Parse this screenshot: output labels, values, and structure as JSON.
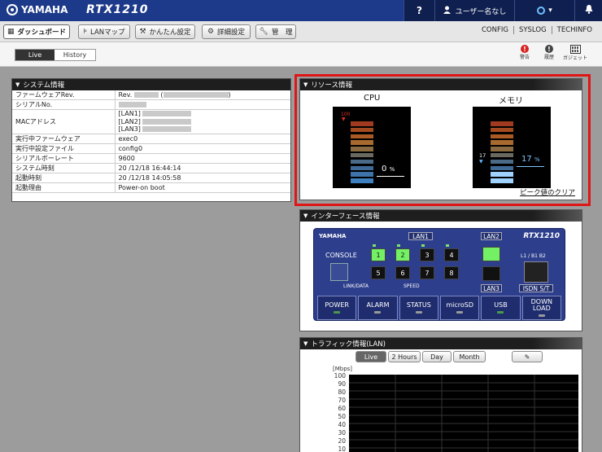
{
  "topbar": {
    "brand": "YAMAHA",
    "model": "RTX1210",
    "help": "?",
    "user": "ユーザー名なし",
    "lang_caret": "▾"
  },
  "menu": {
    "items": [
      {
        "label": "ダッシュボード",
        "icon": "dashboard-icon"
      },
      {
        "label": "LANマップ",
        "icon": "lanmap-icon"
      },
      {
        "label": "かんたん設定",
        "icon": "wrench-person-icon"
      },
      {
        "label": "詳細設定",
        "icon": "gear-icon"
      },
      {
        "label": "管　理",
        "icon": "wrench-icon"
      }
    ],
    "right_links": [
      "CONFIG",
      "SYSLOG",
      "TECHINFO"
    ]
  },
  "subbar": {
    "tabs": [
      "Live",
      "History"
    ],
    "tools": [
      {
        "label": "警告",
        "icon": "warning-icon"
      },
      {
        "label": "履歴",
        "icon": "history-icon"
      },
      {
        "label": "ガジェット",
        "icon": "gadget-icon"
      }
    ]
  },
  "system": {
    "title": "システム情報",
    "rows": [
      {
        "key": "ファームウェアRev.",
        "value": "Rev."
      },
      {
        "key": "シリアルNo.",
        "value": ""
      },
      {
        "key": "MACアドレス",
        "value": "[LAN1]\n[LAN2]\n[LAN3]"
      },
      {
        "key": "実行中ファームウェア",
        "value": "exec0"
      },
      {
        "key": "実行中設定ファイル",
        "value": "config0"
      },
      {
        "key": "シリアルボーレート",
        "value": "9600"
      },
      {
        "key": "システム時刻",
        "value": "20  /12/18 16:44:14"
      },
      {
        "key": "起動時刻",
        "value": "20  /12/18 14:05:58"
      },
      {
        "key": "起動理由",
        "value": "Power-on boot"
      }
    ]
  },
  "resource": {
    "title": "リソース情報",
    "cpu": {
      "label": "CPU",
      "peak": "100",
      "value": "0",
      "unit": "%",
      "level": 0.0
    },
    "memory": {
      "label": "メモリ",
      "peak": "17",
      "value": "17",
      "unit": "%",
      "level": 0.17
    },
    "clear_peak": "ピーク値のクリア"
  },
  "interface": {
    "title": "インターフェース情報",
    "brand": "YAMAHA",
    "model": "RTX1210",
    "console": "CONSOLE",
    "link_data": "LINK/DATA",
    "speed": "SPEED",
    "lan1": "LAN1",
    "lan2": "LAN2",
    "lan3": "LAN3",
    "isdn_top": "L1 / B1 B2",
    "isdn": "ISDN S/T",
    "ports": [
      "1",
      "2",
      "3",
      "4",
      "5",
      "6",
      "7",
      "8"
    ],
    "ports_up": [
      true,
      true,
      false,
      false,
      false,
      false,
      false,
      false
    ],
    "status": [
      {
        "label": "POWER",
        "on": true
      },
      {
        "label": "ALARM",
        "on": false
      },
      {
        "label": "STATUS",
        "on": false
      },
      {
        "label": "microSD",
        "on": false
      },
      {
        "label": "USB",
        "on": true
      },
      {
        "label": "DOWN\nLOAD",
        "on": false
      }
    ]
  },
  "traffic": {
    "title": "トラフィック情報(LAN)",
    "tabs": [
      "Live",
      "2 Hours",
      "Day",
      "Month"
    ],
    "unit": "[Mbps]",
    "yticks": [
      "100",
      "90",
      "80",
      "70",
      "60",
      "50",
      "40",
      "30",
      "20",
      "10"
    ],
    "edit_icon": "pencil-icon"
  },
  "colors": {
    "accent_blue": "#1d3a8a",
    "highlight_red": "#e01515",
    "port_up": "#74f064"
  }
}
